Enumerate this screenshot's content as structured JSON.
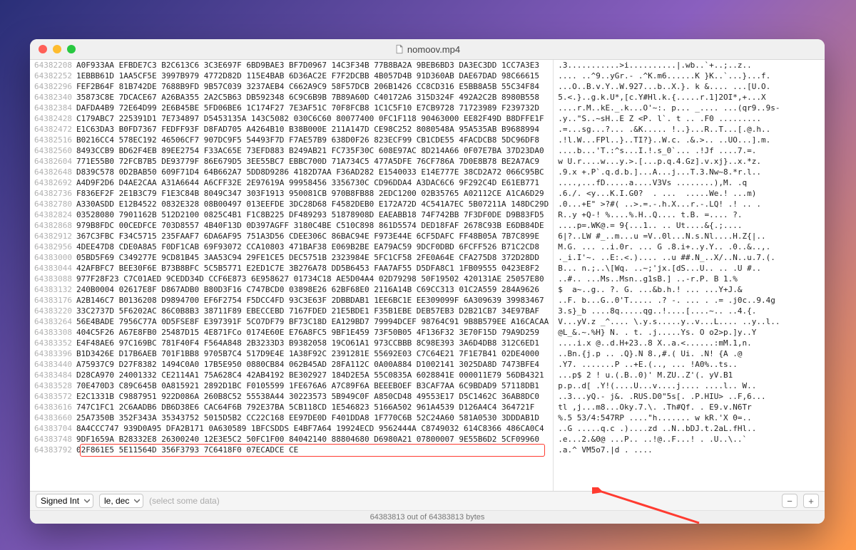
{
  "window": {
    "title": "nomoov.mp4"
  },
  "footer": {
    "format_select": "Signed Int",
    "endian_select": "le, dec",
    "hint": "(select some data)"
  },
  "status": "64383813 out of 64383813 bytes",
  "rows": [
    {
      "o": "64382208",
      "h": "A0F933AA EFBDE7C3 B2C613C6 3C3E697F 6BD9BAE3 BF7D0967 14C3F34B 77B8BA2A 9BEB6BD3 DA3EC3DD 1CC7A3E3",
      "a": ".3...........>i..........|.wb..`+..;..z.."
    },
    {
      "o": "64382252",
      "h": "1EBBB61D 1AA5CF5E 3997B979 4772D82D 115E4BAB 6D36AC2E F7F2DCBB 4B057D4B 91D360AB DAE67DAD 98C66615",
      "a": ".... ..^9..yGr.- .^K.m6......K }K..`...}...f."
    },
    {
      "o": "64382296",
      "h": "FEF2B64F 81B742DE 7688B9FD 9B57C039 3237AEB4 C662A9C9 58F57DCB 206B1426 CC8CD316 E5BB8A5B 55C34F84",
      "a": "...O..B.v.Y..W.927...b..X.}. k &.... ...[U.O."
    },
    {
      "o": "64382340",
      "h": "35873C8E 7DCACE67 A26BA355 2A2C5B63 DB592348 6C9C6B9B 7B89A60D C40172A6 315D324F 492A2C2B 8980B558",
      "a": "5.<.}..g.k.U*,[c.Y#Hl.k.{.....r.1]2OI*,+...X"
    },
    {
      "o": "64382384",
      "h": "DAFDA4B9 72E64D99 2E6B45BE 5FD06BE6 1C174F27 7E3AF51C 70F8FCB8 1C1C5F10 E7CB9728 71723989 F239732D",
      "a": "....r.M..kE._.k...O'~:. p... _.... ...(qr9..9s-"
    },
    {
      "o": "64382428",
      "h": "C179ABC7 225391D1 7E734897 D5453135A 143C5082 030C6C60 80077400 0FC1F118 90463000 EE82F49D B8DFFE1F",
      "a": ".y..\"S..~sH..E Z <P. l`. t .. .F0 ........."
    },
    {
      "o": "64382472",
      "h": "E1C63DA3 B0FD7367 FEDFF93F D8FAD705 A4264B10 B38B000E 211A147D CE98C252 8080548A 95A535AB B9688994",
      "a": ".=...sg...?... .&K..... !..}...R..T...[.@.h.."
    },
    {
      "o": "64382516",
      "h": "B0216CC4 578EC192 46506CF7 907DC9F5 54493F7D F7AE57B9 638D0F26 823ECF99 CB1CDE55 4FACDCB8 5DC96DF8",
      "a": ".!l.W...FPl..}..TI?}..W.c. .&.>.. ..UO...].m."
    },
    {
      "o": "64382560",
      "h": "8493CCB9 BD62F4EB 89EE2754 F33AC65E 73EFD883 B249AB21 FC735F30C 608E97AC 8D214A66 0F07E7BA 37D23DA0",
      "a": "....b...'T.:^s...I.!.s_0`... .!Jf ....7.=."
    },
    {
      "o": "64382604",
      "h": "771E55B0 72FCB7B5 DE93779F 86E679D5 3EE55BC7 EBBC700D 71A734C5 477A5DFE 76CF786A 7D0E8B78 BE2A7AC9",
      "a": "w U.r....w...y.>.[...p.q.4.Gz].v.xj}..x.*z."
    },
    {
      "o": "64382648",
      "h": "D839C578 0D2BAB50 609F71D4 64B662A7 5DD8D9286 4182D7AA F36AD282 E1540033 E14E777E 38CD2A72 066C95BC",
      "a": ".9.x +.P`.q.d.b.]...A...j...T.3.Nw~8.*r.l.."
    },
    {
      "o": "64382692",
      "h": "A4D9F2D6 D4AE2CAA A31A6644 A6CFF32E 2E97619A 99958456 3356730C CD96DDA4 A3DAC6C6 9F292C4D E61EB771",
      "a": "....,...fD.....a....V3Vs ........),M. .q"
    },
    {
      "o": "64382736",
      "h": "F836EF2F 2E1B3C79 F1E3C84B 8049C347 303F1913 950081CB 970B8FB88 2EDC1200 02B35765 A02112CE A1CA6D29",
      "a": ".6./. <y...K.I.G0?  . ...  .....We.! ...m)"
    },
    {
      "o": "64382780",
      "h": "A330ASDD E12B4522 0832E328 08B00497 013EEFDE 3DC28D68 F4582DEB0 E172A72D 4C541A7EC 5B07211A 148DC29D",
      "a": ".0...+E\" >?#( ..>.=.-.h.X...r.-.LQ! .! .. ."
    },
    {
      "o": "64382824",
      "h": "03528080 7901162B 512D2100 0825C4B1 F1C8B225 DF489293 51878908D EAEABB18 74F742BB 7F3DF0DE D9B83FD5",
      "a": "R..y +Q-! %....%.H..Q.... t.B. =.... ?."
    },
    {
      "o": "64382868",
      "h": "979B8FDC 00CEDFCE 703D8557 4B40F13D 0D397AGFF 3180C4BE C510C898 861D5574 DED18FAF 2678C93B E6DB84DE",
      "a": "....p=.WK@.= 9{...1.. .. Ut....&{.;.... "
    },
    {
      "o": "64382912",
      "h": "367C3FBC F34C5715 235FAAF7 6DA6AF95 751A3D56 CDEE306C 86BAC94E F973E44E 6CF5DAFC FF48B05A 7B7C899E",
      "a": "6|?..LW #_..m...u =V..0l...N.s.Nl....H.Z{|.."
    },
    {
      "o": "64382956",
      "h": "4DEE47D8 CDE0A8A5 F0DF1CAB 69F93072 CCA10803 471BAF38 E069B2BE EA79AC59 9DCF0DBD 6FCFF526 B71C2CD8",
      "a": "M.G. ... ..i.0r. ... G .8.i+..y.Y.. .0..&..,."
    },
    {
      "o": "64383000",
      "h": "05BD5F69 C349277E 9CD81B45 3AA53C94 29FE1CE5 DEC5751B 2323984E 5FC1CF58 2FE0A64E CFA275D8 372D28DD",
      "a": "._i.I'~. ..E:.<.).... ..u ##.N_..X/..N..u.7.(."
    },
    {
      "o": "64383044",
      "h": "42AFBFC7 BEE30F6E B73B8BFC 5C5B5771 E2ED1C7E 3B276A78 DD5B6453 FAA7AF55 D5DFA8C1 1FB09555 0423E8F2",
      "a": "B... n.;..\\[Wq. ..~;'jx.[dS...U.. .. .U #.."
    },
    {
      "o": "64383088",
      "h": "977F28F23 C7C01AED 9CEDD34D CCF6E873 6E958627 01734C18 AE5D04A4 02D79298 50F19502 420131AE 25057E80",
      "a": "..#.. ...Ms..Msn..g1sB.] ..-r.P. B 1.%"
    },
    {
      "o": "64383132",
      "h": "240B0004 02617E8F D867ADB0 B80D3F16 C747BCD0 03898E26 62BF68E0 2116A14B C69CC313 01C2A559 284A9626",
      "a": "$  a~..g.. ?. G. ...&b.h.! ... ...Y+J.&"
    },
    {
      "o": "64383176",
      "h": "A2B146C7 B0136208 D9894700 EF6F2754 F5DCC4FD 93C3E63F 2DBBDAB1 1EE6BC1E EE309099F 6A309639 39983467",
      "a": "..F. b...G..0'T..... .? -. ... . .= .j0c..9.4g"
    },
    {
      "o": "64383220",
      "h": "33C2737D 5F6202AC 86C0B8B3 38711F89 EBECCEBD 7167FDED 21E5BDE1 F35B1EBE DEB57EB3 D2B21CB7 34E97BAF",
      "a": "3.s}_b ....8q.....qg..!....[....~.. ..4.{."
    },
    {
      "o": "64383264",
      "h": "56E4BADE 7956C77A 0D5FSE8F E397391F 5CO7DF79 BF73C18D EA129BD7 79994DCEF 98764C91 9B8B579EE A16CACAA",
      "a": "V...yV.z _^.... \\.y.s.....y..v...L.... ..y..l.."
    },
    {
      "o": "64383308",
      "h": "404C5F26 A67E8FB0 25487D15 4E871FCo 0174E60E E76A8FC5 9BF1E459 73F50B05 4F136F32 3E70F15D 79A9D259",
      "a": "@L_&.~.%H} N. . t. .j.....Ys. O o2>p.]y..Y"
    },
    {
      "o": "64383352",
      "h": "E4F48AE6 97C169BC 781F40F4 F564A848 2B3233D3 B9382058 19CO61A1 973CCBBB 8C98E393 3A6D4DB8 312C6ED1",
      "a": "....i.x @..d.H+23..8 X..a.<......:mM.1,n."
    },
    {
      "o": "64383396",
      "h": "B1D3426E D17B6AEB 701F1BB8 9705B7C4 517D9E4E 1A38F92C 2391281E 55692E03 C7C64E21 7F1E7B41 02DE4000",
      "a": "..Bn.{j.p .. .Q}.N 8.,#.( Ui. .N! {A .@ "
    },
    {
      "o": "64383440",
      "h": "A75937C9 D27F8382 1494C0A0 17B5E950 0880CB84 062B45AD 28FA112C 0A00A884 D1002141 3025DA8D 7473BFE4",
      "a": ".Y7. .......P ..+E.(.., ... !A0%..ts.."
    },
    {
      "o": "64383484",
      "h": "D28CA970 24001332 CE2114A1 75A628C4 42AB4192 BE302927 184D2E5A 55C0835A 6028841E 000011E79 56DB4321",
      "a": "...p$ 2 ! u.(.B..0)' M.ZU..Z'(. yV.B1"
    },
    {
      "o": "64383528",
      "h": "70E470D3 C89C645B 0A815921 2892D1BC F0105599 1FE676A6 A7C89F6A BEEEBOEF B3CAF7AA 6C9BDAD9 57118DB1",
      "a": "p.p..d[ .Y!(....U...v....j.... ....l.. W.."
    },
    {
      "o": "64383572",
      "h": "E2C1331B C9887951 922D086A 260B8C52 55538A44 30223573 5B949C0F A850CD48 49553E17 D5C1462C 36AB8DC0",
      "a": "..3...yQ.- j&. .RUS.D0\"5s[. .P.HIU> ..F,6..."
    },
    {
      "o": "64383616",
      "h": "747C1FC1 2C6AADB6 DB6D38E6 CAC64F6B 792E37BA 5CB118CD 1E546823 5166A502 961A4539 D126A4C4 364721F",
      "a": "tl ,j...m8...Oky.7.\\. .Th#Qf. . E9.v.N6Tr"
    },
    {
      "o": "64383660",
      "h": "25A7350B 352F343A 35343752 5015D5B2 CC22C168 EE97DE0D F401DDA8 1F770C6B 52C24A60 581A0530 3DDDAB1D",
      "a": "%.5 53/4:547RP ....\"h....... w kR.'X 0=.."
    },
    {
      "o": "64383704",
      "h": "8A4CCC747 939D0A95 DFA2B171 0A630589 1BFCSDDS E4BF7A64 19924ECD 9562444A C8749032 614C8366 486CA0C4",
      "a": "..G .....q.c .)....zd ..N..bDJ.t.2aL.fHl.."
    },
    {
      "o": "64383748",
      "h": "9DF1659A B28332E8 26300240 12E3E5C2 50FC1F00 84042140 88804680 D6980A21 07800007 9E55B6D2 5CF09960",
      "a": ".e...2.&0@ ...P.. ..!@..F...! . .U..\\..`"
    },
    {
      "o": "64383792",
      "h": "02F861E5 5E11564D 356F3793 7C6418F0 07ECADCE CE",
      "a": ".a.^ VM5o7.|d . ...."
    }
  ],
  "highlight_row_index": 36
}
